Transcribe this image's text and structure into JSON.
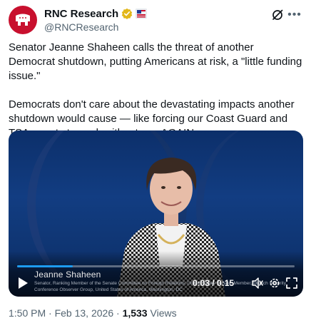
{
  "author": {
    "display_name": "RNC Research",
    "handle": "@RNCResearch"
  },
  "tweet": {
    "paragraph1": "Senator Jeanne Shaheen calls the threat of another Democrat shutdown, putting Americans at risk, a \"little funding issue.\"",
    "paragraph2": "Democrats don't care about the devastating impacts another shutdown would cause — like forcing our Coast Guard and TSA agents to work without pay AGAIN."
  },
  "video": {
    "speaker_name": "Jeanne Shaheen",
    "speaker_title": "Senator, Ranking Member of the Senate Committee on Foreign Relations, United States Senate, Member, Munich Security Conference Observer Group, United States of America, Washington, DC",
    "current_time": "0:03",
    "total_time": "0:15",
    "time_display": "0:03 / 0:15",
    "progress_fraction": 0.2
  },
  "footer": {
    "time": "1:50 PM",
    "separator": "·",
    "date": "Feb 13, 2026",
    "views_count": "1,533",
    "views_label": "Views"
  },
  "colors": {
    "accent": "#1d9bf0",
    "brand_red": "#c8102e",
    "verified_gold": "#e2b719"
  },
  "icons": [
    "rnc-elephant-logo",
    "verified-gold-badge",
    "affiliate-badge",
    "grok-icon",
    "more-icon",
    "play-icon",
    "volume-icon",
    "settings-icon",
    "fullscreen-icon"
  ]
}
